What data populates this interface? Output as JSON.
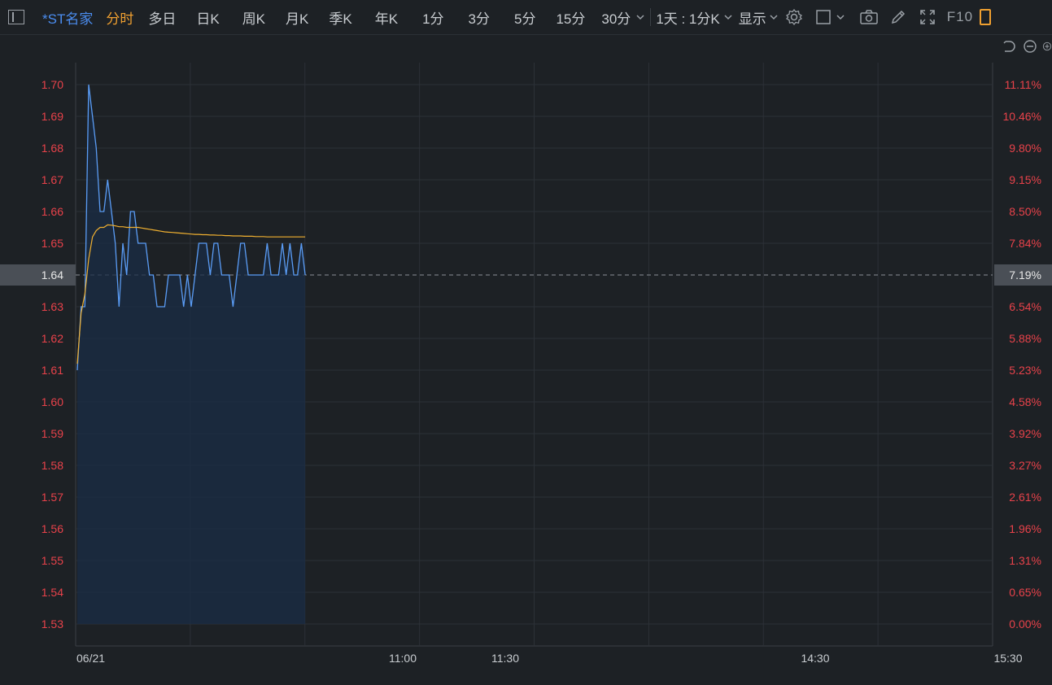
{
  "toolbar": {
    "symbol": "*ST名家",
    "periods": [
      {
        "label": "分时",
        "active": true
      },
      {
        "label": "多日",
        "active": false
      },
      {
        "label": "日K",
        "active": false
      },
      {
        "label": "周K",
        "active": false
      },
      {
        "label": "月K",
        "active": false
      },
      {
        "label": "季K",
        "active": false
      },
      {
        "label": "年K",
        "active": false
      },
      {
        "label": "1分",
        "active": false
      },
      {
        "label": "3分",
        "active": false
      },
      {
        "label": "5分",
        "active": false
      },
      {
        "label": "15分",
        "active": false
      },
      {
        "label": "30分",
        "active": false
      }
    ],
    "range_select": "1天 : 1分K",
    "display_label": "显示",
    "f10_label": "F10"
  },
  "colors": {
    "background": "#1d2125",
    "price_line": "#5a9cf5",
    "avg_line": "#f0b030",
    "axis_text": "#e8424a",
    "grid": "#2c3137",
    "fill": "#1a2c45"
  },
  "chart_data": {
    "type": "line",
    "date_label": "06/21",
    "x_ticks": [
      "11:00",
      "11:30",
      "14:30",
      "15:30"
    ],
    "prev_close": 1.53,
    "ref_price": 1.64,
    "ref_price_label": "1.64",
    "ref_pct_label": "7.19%",
    "ylim": [
      1.53,
      1.7
    ],
    "left_ticks": [
      "1.70",
      "1.69",
      "1.68",
      "1.67",
      "1.66",
      "1.65",
      "1.64",
      "1.63",
      "1.62",
      "1.61",
      "1.60",
      "1.59",
      "1.58",
      "1.57",
      "1.56",
      "1.55",
      "1.54",
      "1.53"
    ],
    "right_ticks": [
      "11.11%",
      "10.46%",
      "9.80%",
      "9.15%",
      "8.50%",
      "7.84%",
      "7.19%",
      "6.54%",
      "5.88%",
      "5.23%",
      "4.58%",
      "3.92%",
      "3.27%",
      "2.61%",
      "1.96%",
      "1.31%",
      "0.65%",
      "0.00%"
    ],
    "series": [
      {
        "name": "price",
        "values": [
          1.61,
          1.63,
          1.63,
          1.7,
          1.69,
          1.68,
          1.66,
          1.66,
          1.67,
          1.66,
          1.65,
          1.63,
          1.65,
          1.64,
          1.66,
          1.66,
          1.65,
          1.65,
          1.65,
          1.64,
          1.64,
          1.63,
          1.63,
          1.63,
          1.64,
          1.64,
          1.64,
          1.64,
          1.63,
          1.64,
          1.63,
          1.64,
          1.65,
          1.65,
          1.65,
          1.64,
          1.65,
          1.65,
          1.64,
          1.64,
          1.64,
          1.63,
          1.64,
          1.65,
          1.65,
          1.64,
          1.64,
          1.64,
          1.64,
          1.64,
          1.65,
          1.64,
          1.64,
          1.64,
          1.65,
          1.64,
          1.65,
          1.64,
          1.64,
          1.65,
          1.64
        ]
      },
      {
        "name": "average",
        "values": [
          1.612,
          1.628,
          1.634,
          1.645,
          1.652,
          1.654,
          1.655,
          1.655,
          1.6558,
          1.6557,
          1.6555,
          1.6552,
          1.6552,
          1.655,
          1.655,
          1.655,
          1.655,
          1.6548,
          1.6546,
          1.6544,
          1.6542,
          1.654,
          1.6538,
          1.6536,
          1.6535,
          1.6534,
          1.6533,
          1.6532,
          1.6531,
          1.653,
          1.6529,
          1.6528,
          1.6528,
          1.6527,
          1.6527,
          1.6526,
          1.6526,
          1.6525,
          1.6525,
          1.6524,
          1.6524,
          1.6523,
          1.6523,
          1.6523,
          1.6522,
          1.6522,
          1.6522,
          1.6521,
          1.6521,
          1.6521,
          1.652,
          1.652,
          1.652,
          1.652,
          1.652,
          1.652,
          1.652,
          1.652,
          1.652,
          1.652,
          1.652
        ]
      }
    ]
  }
}
